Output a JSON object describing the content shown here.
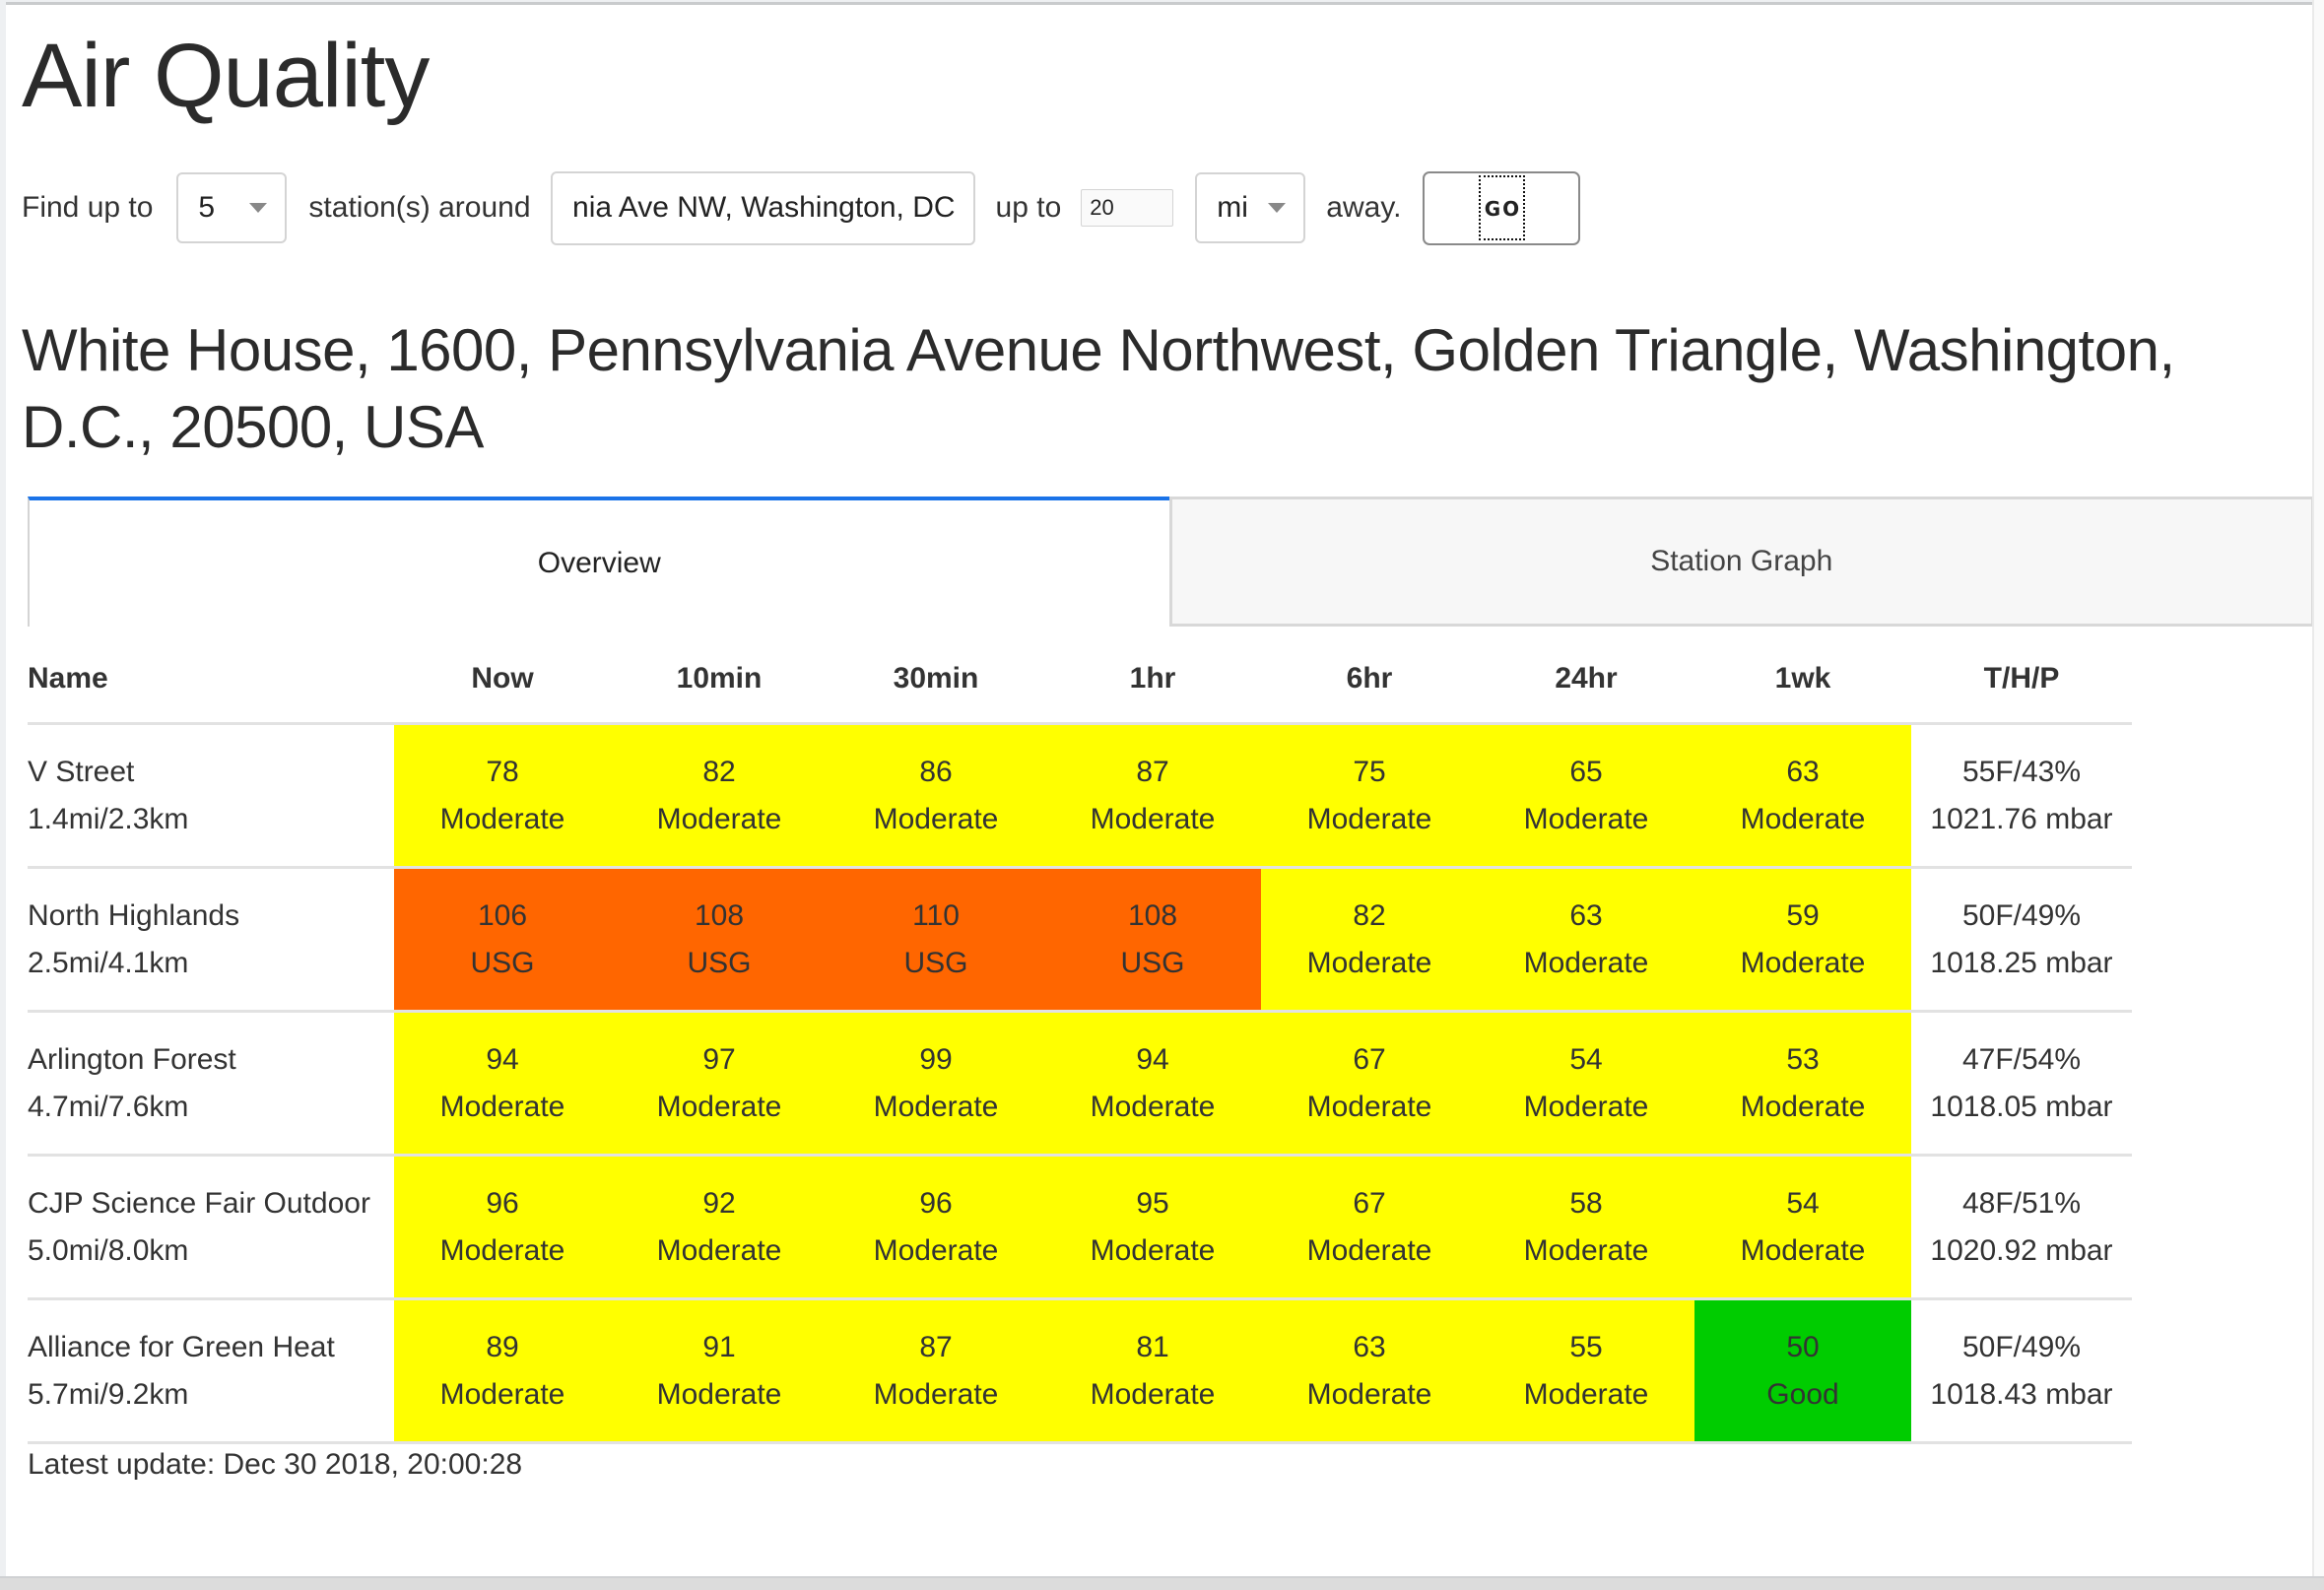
{
  "page": {
    "title": "Air Quality"
  },
  "search": {
    "label_find": "Find up to",
    "count_value": "5",
    "label_around": "station(s) around",
    "address_value": "nia Ave NW, Washington, DC",
    "label_upto": "up to",
    "distance_value": "20",
    "unit_value": "mi",
    "label_away": "away.",
    "go_label": "GO"
  },
  "location": {
    "heading": "White House, 1600, Pennsylvania Avenue Northwest, Golden Triangle, Washington, D.C., 20500, USA"
  },
  "tabs": [
    {
      "label": "Overview",
      "active": true
    },
    {
      "label": "Station Graph",
      "active": false
    }
  ],
  "colors": {
    "Good": "#00cc00",
    "Moderate": "#ffff00",
    "USG": "#ff6600",
    "tab_active_accent": "#1a73e8"
  },
  "table": {
    "headers": [
      "Name",
      "Now",
      "10min",
      "30min",
      "1hr",
      "6hr",
      "24hr",
      "1wk",
      "T/H/P"
    ],
    "rows": [
      {
        "name": "V Street",
        "distance": "1.4mi/2.3km",
        "readings": [
          {
            "value": "78",
            "category": "Moderate"
          },
          {
            "value": "82",
            "category": "Moderate"
          },
          {
            "value": "86",
            "category": "Moderate"
          },
          {
            "value": "87",
            "category": "Moderate"
          },
          {
            "value": "75",
            "category": "Moderate"
          },
          {
            "value": "65",
            "category": "Moderate"
          },
          {
            "value": "63",
            "category": "Moderate"
          }
        ],
        "temp_humidity": "55F/43%",
        "pressure": "1021.76 mbar"
      },
      {
        "name": "North Highlands",
        "distance": "2.5mi/4.1km",
        "readings": [
          {
            "value": "106",
            "category": "USG"
          },
          {
            "value": "108",
            "category": "USG"
          },
          {
            "value": "110",
            "category": "USG"
          },
          {
            "value": "108",
            "category": "USG"
          },
          {
            "value": "82",
            "category": "Moderate"
          },
          {
            "value": "63",
            "category": "Moderate"
          },
          {
            "value": "59",
            "category": "Moderate"
          }
        ],
        "temp_humidity": "50F/49%",
        "pressure": "1018.25 mbar"
      },
      {
        "name": "Arlington Forest",
        "distance": "4.7mi/7.6km",
        "readings": [
          {
            "value": "94",
            "category": "Moderate"
          },
          {
            "value": "97",
            "category": "Moderate"
          },
          {
            "value": "99",
            "category": "Moderate"
          },
          {
            "value": "94",
            "category": "Moderate"
          },
          {
            "value": "67",
            "category": "Moderate"
          },
          {
            "value": "54",
            "category": "Moderate"
          },
          {
            "value": "53",
            "category": "Moderate"
          }
        ],
        "temp_humidity": "47F/54%",
        "pressure": "1018.05 mbar"
      },
      {
        "name": "CJP Science Fair Outdoor",
        "distance": "5.0mi/8.0km",
        "readings": [
          {
            "value": "96",
            "category": "Moderate"
          },
          {
            "value": "92",
            "category": "Moderate"
          },
          {
            "value": "96",
            "category": "Moderate"
          },
          {
            "value": "95",
            "category": "Moderate"
          },
          {
            "value": "67",
            "category": "Moderate"
          },
          {
            "value": "58",
            "category": "Moderate"
          },
          {
            "value": "54",
            "category": "Moderate"
          }
        ],
        "temp_humidity": "48F/51%",
        "pressure": "1020.92 mbar"
      },
      {
        "name": "Alliance for Green Heat",
        "distance": "5.7mi/9.2km",
        "readings": [
          {
            "value": "89",
            "category": "Moderate"
          },
          {
            "value": "91",
            "category": "Moderate"
          },
          {
            "value": "87",
            "category": "Moderate"
          },
          {
            "value": "81",
            "category": "Moderate"
          },
          {
            "value": "63",
            "category": "Moderate"
          },
          {
            "value": "55",
            "category": "Moderate"
          },
          {
            "value": "50",
            "category": "Good"
          }
        ],
        "temp_humidity": "50F/49%",
        "pressure": "1018.43 mbar"
      }
    ]
  },
  "footer": {
    "latest_update": "Latest update: Dec 30 2018, 20:00:28"
  }
}
